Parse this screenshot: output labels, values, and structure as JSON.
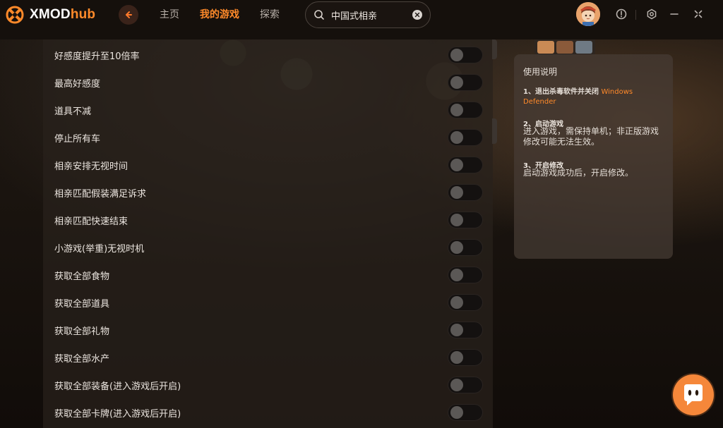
{
  "app": {
    "brand_main": "XMOD",
    "brand_accent": "hub",
    "accent_color": "#ff8a2a"
  },
  "nav": {
    "back_icon": "arrow-left-icon",
    "items": [
      {
        "label": "主页",
        "active": false
      },
      {
        "label": "我的游戏",
        "active": true
      },
      {
        "label": "探索",
        "active": false
      }
    ]
  },
  "search": {
    "value": "中国式相亲",
    "icon": "search-icon",
    "clear_icon": "close-circle-icon"
  },
  "header_actions": {
    "avatar": "avatar",
    "icons": [
      "alert-icon",
      "settings-icon",
      "minimize-icon",
      "close-icon"
    ]
  },
  "options": [
    {
      "label": "好感度提升至10倍率",
      "on": false
    },
    {
      "label": "最高好感度",
      "on": false
    },
    {
      "label": "道具不减",
      "on": false
    },
    {
      "label": "停止所有车",
      "on": false
    },
    {
      "label": "相亲安排无视时间",
      "on": false
    },
    {
      "label": "相亲匹配假装满足诉求",
      "on": false
    },
    {
      "label": "相亲匹配快速结束",
      "on": false
    },
    {
      "label": "小游戏(举重)无视时机",
      "on": false
    },
    {
      "label": "获取全部食物",
      "on": false
    },
    {
      "label": "获取全部道具",
      "on": false
    },
    {
      "label": "获取全部礼物",
      "on": false
    },
    {
      "label": "获取全部水产",
      "on": false
    },
    {
      "label": "获取全部装备(进入游戏后开启)",
      "on": false
    },
    {
      "label": "获取全部卡牌(进入游戏后开启)",
      "on": false
    }
  ],
  "help": {
    "title": "使用说明",
    "step1_prefix": "1、退出杀毒软件并关闭",
    "step1_link": "Windows Defender",
    "step2_title": "2、启动游戏",
    "step2_text": "进入游戏，需保持单机；非正版游戏修改可能无法生效。",
    "step3_title": "3、开启修改",
    "step3_text": "启动游戏成功后，开启修改。"
  },
  "chat": {
    "icon": "chat-bot-icon"
  }
}
